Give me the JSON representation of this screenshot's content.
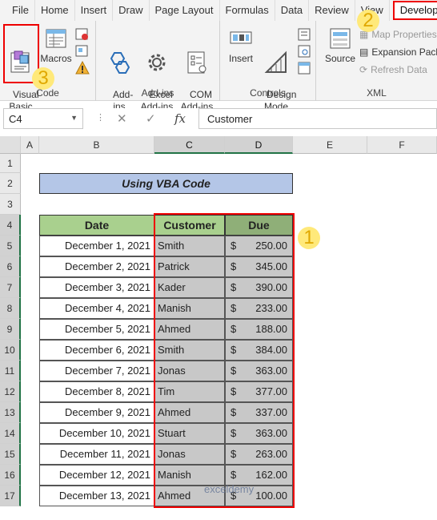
{
  "tabs": [
    "File",
    "Home",
    "Insert",
    "Draw",
    "Page Layout",
    "Formulas",
    "Data",
    "Review",
    "View",
    "Developer"
  ],
  "ribbon": {
    "code": {
      "label": "Code",
      "visual_basic": "Visual\nBasic",
      "macros": "Macros"
    },
    "addins": {
      "label": "Add-ins",
      "addins": "Add-\nins",
      "excel_addins": "Excel\nAdd-ins",
      "com_addins": "COM\nAdd-ins"
    },
    "controls": {
      "label": "Controls",
      "insert": "Insert",
      "design_mode": "Design\nMode"
    },
    "xml": {
      "label": "XML",
      "source": "Source",
      "map_properties": "Map Properties",
      "expansion_packs": "Expansion Packs",
      "refresh_data": "Refresh Data"
    }
  },
  "formula_bar": {
    "name_box": "C4",
    "formula": "Customer",
    "fx": "fx"
  },
  "columns": [
    "A",
    "B",
    "C",
    "D",
    "E",
    "F"
  ],
  "rows": [
    "1",
    "2",
    "3",
    "4",
    "5",
    "6",
    "7",
    "8",
    "9",
    "10",
    "11",
    "12",
    "13",
    "14",
    "15",
    "16",
    "17"
  ],
  "sheet": {
    "title": "Using VBA Code",
    "headers": {
      "date": "Date",
      "customer": "Customer",
      "due": "Due"
    },
    "records": [
      {
        "date": "December 1, 2021",
        "customer": "Smith",
        "cur": "$",
        "due": "250.00"
      },
      {
        "date": "December 2, 2021",
        "customer": "Patrick",
        "cur": "$",
        "due": "345.00"
      },
      {
        "date": "December 3, 2021",
        "customer": "Kader",
        "cur": "$",
        "due": "390.00"
      },
      {
        "date": "December 4, 2021",
        "customer": "Manish",
        "cur": "$",
        "due": "233.00"
      },
      {
        "date": "December 5, 2021",
        "customer": "Ahmed",
        "cur": "$",
        "due": "188.00"
      },
      {
        "date": "December 6, 2021",
        "customer": "Smith",
        "cur": "$",
        "due": "384.00"
      },
      {
        "date": "December 7, 2021",
        "customer": "Jonas",
        "cur": "$",
        "due": "363.00"
      },
      {
        "date": "December 8, 2021",
        "customer": "Tim",
        "cur": "$",
        "due": "377.00"
      },
      {
        "date": "December 9, 2021",
        "customer": "Ahmed",
        "cur": "$",
        "due": "337.00"
      },
      {
        "date": "December 10, 2021",
        "customer": "Stuart",
        "cur": "$",
        "due": "363.00"
      },
      {
        "date": "December 11, 2021",
        "customer": "Jonas",
        "cur": "$",
        "due": "263.00"
      },
      {
        "date": "December 12, 2021",
        "customer": "Manish",
        "cur": "$",
        "due": "162.00"
      },
      {
        "date": "December 13, 2021",
        "customer": "Ahmed",
        "cur": "$",
        "due": "100.00"
      }
    ]
  },
  "badges": {
    "one": "1",
    "two": "2",
    "three": "3"
  },
  "watermark": "exceldemy",
  "colors": {
    "title_fill": "#b4c6e7",
    "date_header_fill": "#a9d08e",
    "customer_header_fill": "#a9d08e",
    "due_header_fill": "#8faf78",
    "selection": "#c8c8c8",
    "highlight_border": "#e00000",
    "badge": "#ffe97a"
  }
}
